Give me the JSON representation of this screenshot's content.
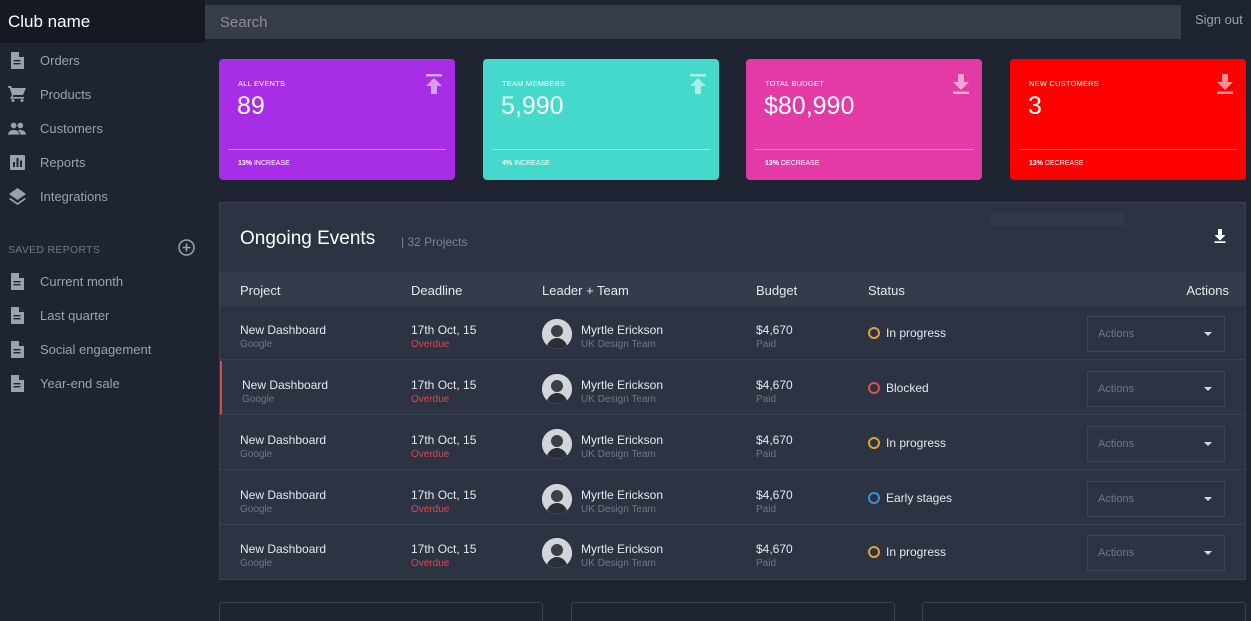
{
  "app": {
    "brand": "Club name"
  },
  "sidebar": {
    "items": [
      {
        "label": "Orders",
        "icon": "document-icon"
      },
      {
        "label": "Products",
        "icon": "cart-icon"
      },
      {
        "label": "Customers",
        "icon": "people-icon"
      },
      {
        "label": "Reports",
        "icon": "bar-chart-icon"
      },
      {
        "label": "Integrations",
        "icon": "layers-icon"
      }
    ],
    "saved_heading": "SAVED REPORTS",
    "saved": [
      {
        "label": "Current month",
        "icon": "document-icon"
      },
      {
        "label": "Last quarter",
        "icon": "document-icon"
      },
      {
        "label": "Social engagement",
        "icon": "document-icon"
      },
      {
        "label": "Year-end sale",
        "icon": "document-icon"
      }
    ]
  },
  "topbar": {
    "search_placeholder": "Search",
    "signout": "Sign out"
  },
  "stats": [
    {
      "title": "ALL EVENTS",
      "value": "89",
      "foot_pct": "13%",
      "foot_text": " INCREASE",
      "icon": "upload-icon",
      "color": "#a72ee6"
    },
    {
      "title": "TEAM MEMBERS",
      "value": "5,990",
      "foot_pct": "4%",
      "foot_text": " INCREASE",
      "icon": "upload-icon",
      "color": "#44d9cb"
    },
    {
      "title": "TOTAL BUDGET",
      "value": "$80,990",
      "foot_pct": "13%",
      "foot_text": " DECREASE",
      "icon": "download-icon",
      "color": "#e33aa6"
    },
    {
      "title": "NEW CUSTOMERS",
      "value": "3",
      "foot_pct": "13%",
      "foot_text": " DECREASE",
      "icon": "download-icon",
      "color": "#ff0000"
    }
  ],
  "events": {
    "title": "Ongoing Events",
    "subtitle": "| 32 Projects",
    "columns": [
      "Project",
      "Deadline",
      "Leader + Team",
      "Budget",
      "Status",
      "Actions"
    ],
    "rows": [
      {
        "project": "New Dashboard",
        "client": "Google",
        "deadline": "17th Oct, 15",
        "deadline_note": "Overdue",
        "leader": "Myrtle Erickson",
        "team": "UK Design Team",
        "budget": "$4,670",
        "budget_note": "Paid",
        "status": "In progress",
        "status_color": "#e0a13a",
        "action": "Actions"
      },
      {
        "project": "New Dashboard",
        "client": "Google",
        "deadline": "17th Oct, 15",
        "deadline_note": "Overdue",
        "leader": "Myrtle Erickson",
        "team": "UK Design Team",
        "budget": "$4,670",
        "budget_note": "Paid",
        "status": "Blocked",
        "status_color": "#d9534f",
        "action": "Actions"
      },
      {
        "project": "New Dashboard",
        "client": "Google",
        "deadline": "17th Oct, 15",
        "deadline_note": "Overdue",
        "leader": "Myrtle Erickson",
        "team": "UK Design Team",
        "budget": "$4,670",
        "budget_note": "Paid",
        "status": "In progress",
        "status_color": "#e0a13a",
        "action": "Actions"
      },
      {
        "project": "New Dashboard",
        "client": "Google",
        "deadline": "17th Oct, 15",
        "deadline_note": "Overdue",
        "leader": "Myrtle Erickson",
        "team": "UK Design Team",
        "budget": "$4,670",
        "budget_note": "Paid",
        "status": "Early stages",
        "status_color": "#3a8fd9",
        "action": "Actions"
      },
      {
        "project": "New Dashboard",
        "client": "Google",
        "deadline": "17th Oct, 15",
        "deadline_note": "Overdue",
        "leader": "Myrtle Erickson",
        "team": "UK Design Team",
        "budget": "$4,670",
        "budget_note": "Paid",
        "status": "In progress",
        "status_color": "#e0a13a",
        "action": "Actions"
      }
    ]
  }
}
